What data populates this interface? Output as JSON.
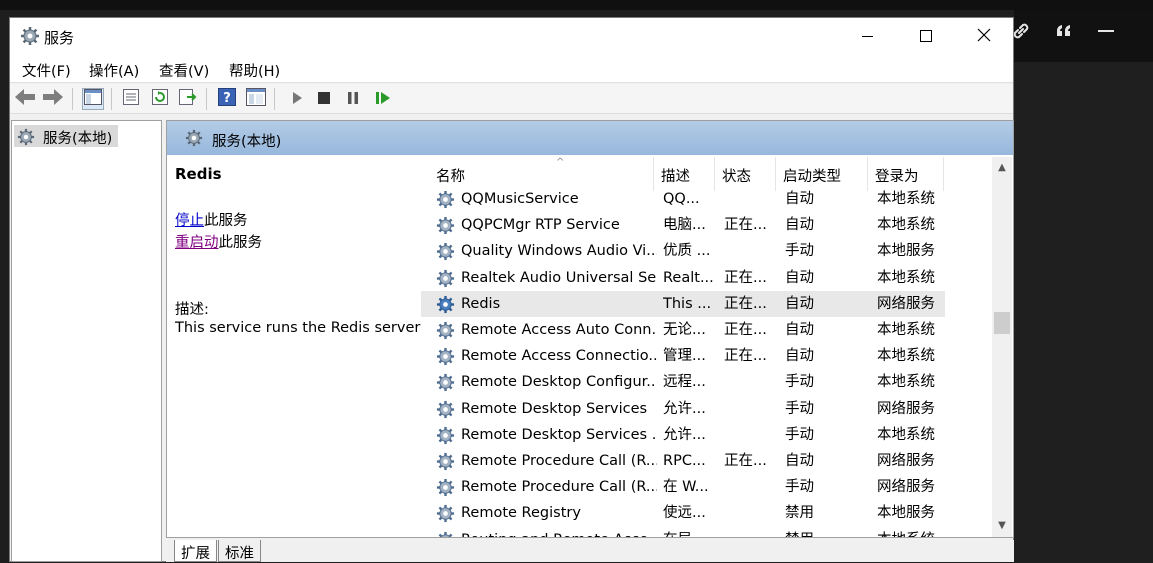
{
  "window": {
    "title": "服务",
    "title_icon": "gear-icon"
  },
  "window_controls": {
    "minimize": "minimize-icon",
    "maximize": "maximize-icon",
    "close": "close-icon"
  },
  "menu": [
    {
      "label": "文件(F)"
    },
    {
      "label": "操作(A)"
    },
    {
      "label": "查看(V)"
    },
    {
      "label": "帮助(H)"
    }
  ],
  "toolbar": [
    "back-arrow-icon",
    "forward-arrow-icon",
    "show-hide-tree-icon",
    "properties-icon",
    "refresh-icon",
    "export-list-icon",
    "help-icon",
    "view-icon",
    "start-icon",
    "stop-icon",
    "pause-icon",
    "resume-icon"
  ],
  "tree": {
    "root_label": "服务(本地)"
  },
  "main": {
    "header_title": "服务(本地)"
  },
  "description": {
    "service_name": "Redis",
    "stop_link": "停止",
    "stop_suffix": "此服务",
    "restart_link": "重启动",
    "restart_suffix": "此服务",
    "label": "描述:",
    "text": "This service runs the Redis server"
  },
  "columns": [
    "名称",
    "描述",
    "状态",
    "启动类型",
    "登录为"
  ],
  "services": [
    {
      "name": "QQMusicService",
      "desc": "QQ...",
      "status": "",
      "startup": "自动",
      "logon": "本地系统"
    },
    {
      "name": "QQPCMgr RTP Service",
      "desc": "电脑...",
      "status": "正在...",
      "startup": "自动",
      "logon": "本地系统"
    },
    {
      "name": "Quality Windows Audio Vi...",
      "desc": "优质 ...",
      "status": "",
      "startup": "手动",
      "logon": "本地服务"
    },
    {
      "name": "Realtek Audio Universal Se...",
      "desc": "Realt...",
      "status": "正在...",
      "startup": "自动",
      "logon": "本地系统"
    },
    {
      "name": "Redis",
      "desc": "This ...",
      "status": "正在...",
      "startup": "自动",
      "logon": "网络服务",
      "selected": true
    },
    {
      "name": "Remote Access Auto Conn...",
      "desc": "无论...",
      "status": "正在...",
      "startup": "自动",
      "logon": "本地系统"
    },
    {
      "name": "Remote Access Connectio...",
      "desc": "管理...",
      "status": "正在...",
      "startup": "自动",
      "logon": "本地系统"
    },
    {
      "name": "Remote Desktop Configur...",
      "desc": "远程...",
      "status": "",
      "startup": "手动",
      "logon": "本地系统"
    },
    {
      "name": "Remote Desktop Services",
      "desc": "允许...",
      "status": "",
      "startup": "手动",
      "logon": "网络服务"
    },
    {
      "name": "Remote Desktop Services ...",
      "desc": "允许...",
      "status": "",
      "startup": "手动",
      "logon": "本地系统"
    },
    {
      "name": "Remote Procedure Call (R...",
      "desc": "RPC...",
      "status": "正在...",
      "startup": "自动",
      "logon": "网络服务"
    },
    {
      "name": "Remote Procedure Call (R...",
      "desc": "在 W...",
      "status": "",
      "startup": "手动",
      "logon": "网络服务"
    },
    {
      "name": "Remote Registry",
      "desc": "使远...",
      "status": "",
      "startup": "禁用",
      "logon": "本地服务"
    },
    {
      "name": "Routing and Remote Acce...",
      "desc": "在局...",
      "status": "",
      "startup": "禁用",
      "logon": "本地系统"
    }
  ],
  "tabs": [
    {
      "label": "扩展"
    },
    {
      "label": "标准"
    }
  ],
  "external_toolbar": [
    "link-icon",
    "quote-icon",
    "minus-icon"
  ]
}
